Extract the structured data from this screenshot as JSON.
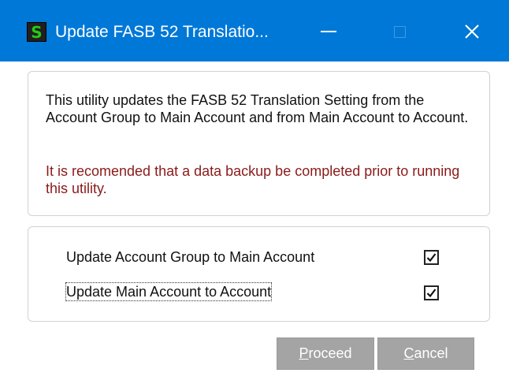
{
  "window": {
    "title": "Update FASB 52 Translatio...",
    "app_icon_letter": "S",
    "app_icon_color": "#28c818",
    "titlebar_color": "#0078d7"
  },
  "info": {
    "description": "This utility updates the FASB 52 Translation Setting from the Account Group to Main Account and from Main Account to Account.",
    "warning": "It is recomended that a data backup be completed prior to running this utility.",
    "warning_color": "#8b1a1a"
  },
  "options": [
    {
      "label": "Update Account Group to Main Account",
      "checked": true
    },
    {
      "label": "Update Main Account to Account",
      "checked": true
    }
  ],
  "buttons": {
    "proceed": {
      "mnemonic": "P",
      "rest": "roceed"
    },
    "cancel": {
      "mnemonic": "C",
      "rest": "ancel"
    }
  }
}
